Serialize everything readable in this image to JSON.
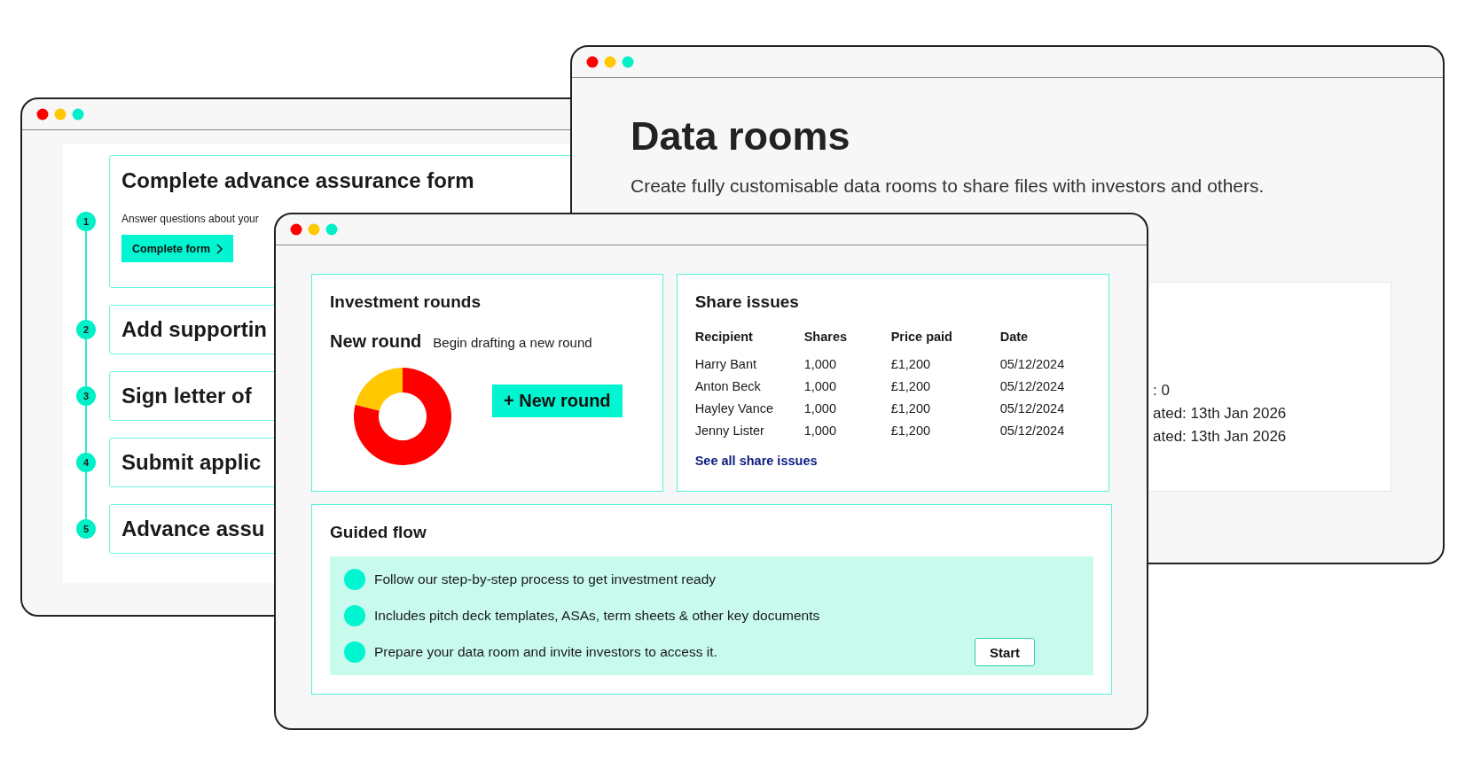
{
  "assurance_window": {
    "steps": [
      {
        "number": "1",
        "title": "Complete advance assurance form",
        "description": "Answer questions about your",
        "button": "Complete form"
      },
      {
        "number": "2",
        "title": "Add supportin"
      },
      {
        "number": "3",
        "title": "Sign letter of"
      },
      {
        "number": "4",
        "title": "Submit applic"
      },
      {
        "number": "5",
        "title": "Advance assu"
      }
    ]
  },
  "data_rooms_window": {
    "title": "Data rooms",
    "subtitle": "Create fully customisable data rooms to share files with investors and others.",
    "card_lines": [
      ": 0",
      "ated: 13th Jan 2026",
      "ated: 13th Jan 2026"
    ]
  },
  "dashboard_window": {
    "investment_rounds": {
      "title": "Investment rounds",
      "subtitle": "New round",
      "description": "Begin drafting a new round",
      "button": "+ New round"
    },
    "share_issues": {
      "title": "Share issues",
      "columns": [
        "Recipient",
        "Shares",
        "Price paid",
        "Date"
      ],
      "rows": [
        [
          "Harry Bant",
          "1,000",
          "£1,200",
          "05/12/2024"
        ],
        [
          "Anton Beck",
          "1,000",
          "£1,200",
          "05/12/2024"
        ],
        [
          "Hayley Vance",
          "1,000",
          "£1,200",
          "05/12/2024"
        ],
        [
          "Jenny Lister",
          "1,000",
          "£1,200",
          "05/12/2024"
        ]
      ],
      "link": "See all share issues"
    },
    "guided_flow": {
      "title": "Guided flow",
      "items": [
        "Follow our step-by-step process to get investment ready",
        "Includes pitch deck templates, ASAs, term sheets & other key documents",
        "Prepare your data room and invite investors to access it."
      ],
      "button": "Start"
    }
  }
}
